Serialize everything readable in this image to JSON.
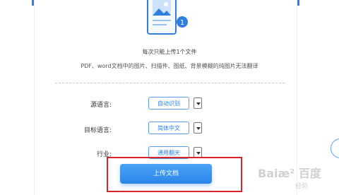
{
  "upload_area": {
    "line1": "每次只能上传1个文件",
    "line2": "PDF、word文档中的图片、扫描件、图纸、背景模糊的纯图片无法翻译",
    "badge": "1"
  },
  "form": {
    "source_label": "源语言:",
    "source_value": "自动识别",
    "target_label": "目标语言:",
    "target_value": "简体中文",
    "industry_label": "行业:",
    "industry_value": "通用翻天"
  },
  "upload_button": "上传文档",
  "watermark": {
    "main": "Baiæ² 百度",
    "sub": "经验"
  },
  "colors": {
    "accent": "#2f7fe0",
    "highlight": "#d9232b"
  }
}
